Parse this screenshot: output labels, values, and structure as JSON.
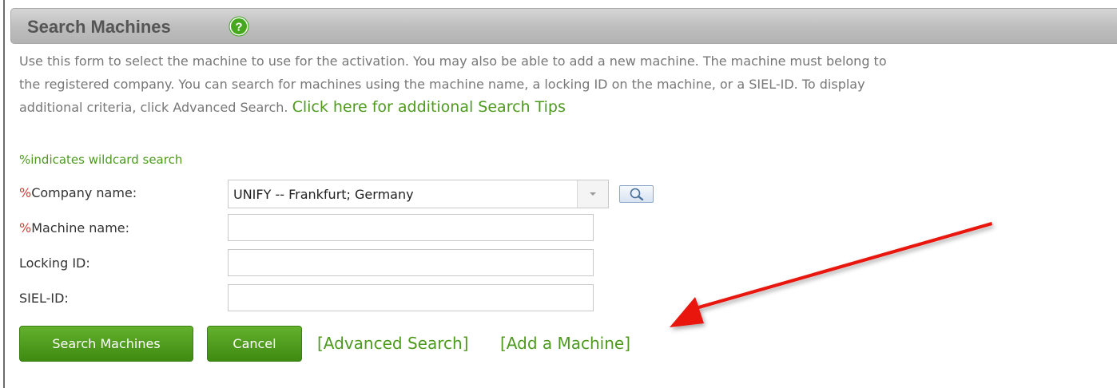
{
  "header": {
    "title": "Search Machines",
    "help_icon": "question-circle-icon"
  },
  "intro": {
    "text": "Use this form to select the machine to use for the activation. You may also be able to add a new machine. The machine must belong to the registered company. You can search for machines using the machine name, a locking ID on the machine, or a SIEL-ID. To display additional criteria, click Advanced Search. ",
    "tips_link": "Click here for additional Search Tips"
  },
  "wildcard_note": "%indicates wildcard search",
  "form": {
    "wildcard_symbol": "%",
    "company": {
      "label": "Company name:",
      "value": "UNIFY -- Frankfurt; Germany"
    },
    "machine_name": {
      "label": "Machine name:",
      "value": ""
    },
    "locking_id": {
      "label": "Locking ID:",
      "value": ""
    },
    "siel_id": {
      "label": "SIEL-ID:",
      "value": ""
    }
  },
  "actions": {
    "search_label": "Search Machines",
    "cancel_label": "Cancel",
    "advanced_link": "[Advanced Search]",
    "add_machine_link": "[Add a Machine]"
  },
  "colors": {
    "accent_green": "#4d9a1f",
    "button_green": "#4f9d1d",
    "wildcard_red": "#d23b3b",
    "annotation_arrow": "#e8140f"
  }
}
